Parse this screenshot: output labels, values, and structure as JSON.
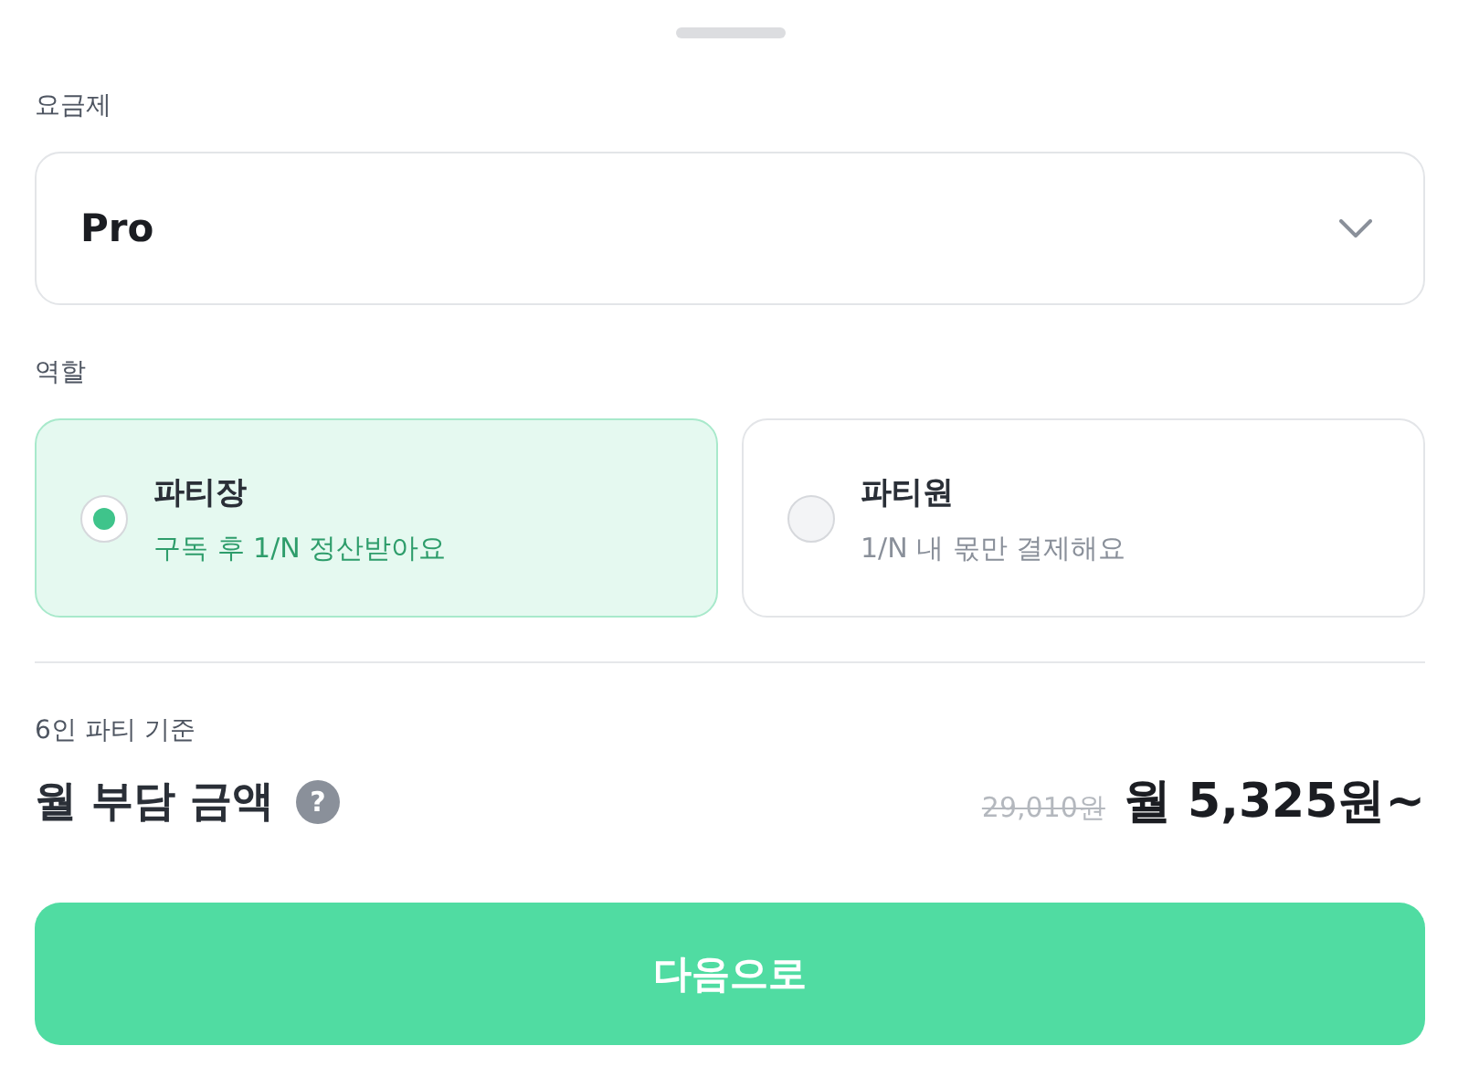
{
  "plan": {
    "label": "요금제",
    "value": "Pro"
  },
  "role": {
    "label": "역할",
    "options": [
      {
        "title": "파티장",
        "description": "구독 후 1/N 정산받아요",
        "selected": true
      },
      {
        "title": "파티원",
        "description": "1/N 내 몫만 결제해요",
        "selected": false
      }
    ]
  },
  "summary": {
    "caption": "6인 파티 기준",
    "title": "월 부담 금액",
    "help": "?",
    "original_price": "29,010원",
    "price": "월 5,325원~"
  },
  "next_button": "다음으로"
}
